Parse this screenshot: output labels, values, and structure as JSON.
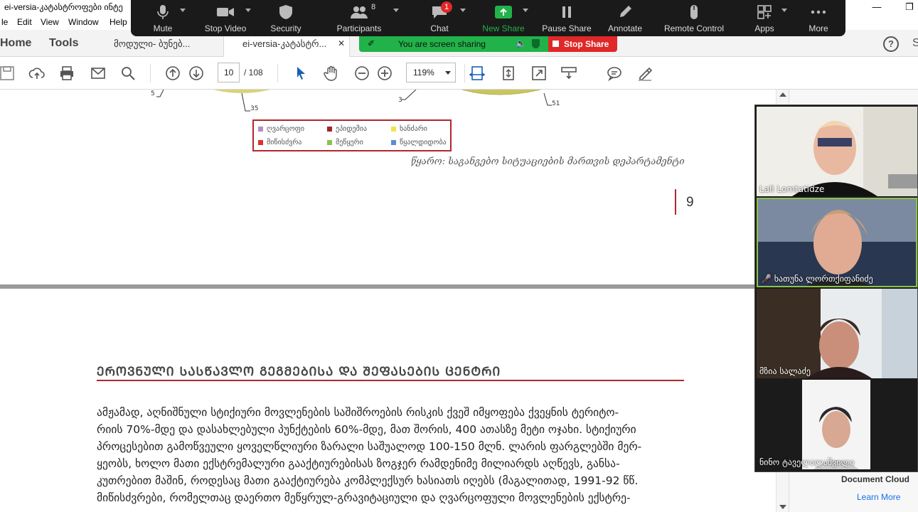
{
  "window": {
    "title": "ei-versia-კატასტროფები ინტე",
    "minimize": "—",
    "restore": "❐"
  },
  "menu": {
    "items": [
      "le",
      "Edit",
      "View",
      "Window",
      "Help"
    ]
  },
  "tabs": {
    "home": "Home",
    "tools": "Tools",
    "doc1": "მოდული- ბუნებ...",
    "doc2": "ei-versia-კატასტრ...",
    "close": "✕",
    "s_label": "S"
  },
  "toolbar": {
    "page_current": "10",
    "page_total": "/ 108",
    "zoom": "119%"
  },
  "zoom_bar": {
    "mute": "Mute",
    "stop_video": "Stop Video",
    "security": "Security",
    "participants": "Participants",
    "participants_count": "8",
    "chat": "Chat",
    "chat_badge": "1",
    "new_share": "New Share",
    "pause_share": "Pause Share",
    "annotate": "Annotate",
    "remote_control": "Remote Control",
    "apps": "Apps",
    "more": "More",
    "sharing_banner": "You are screen sharing",
    "stop_share": "Stop Share"
  },
  "document": {
    "chart_labels": [
      "5",
      "35",
      "3",
      "51"
    ],
    "legend": [
      {
        "label": "ღვარცოფი",
        "color": "#b48fc4"
      },
      {
        "label": "ეპიდემია",
        "color": "#a3232b"
      },
      {
        "label": "ხანძარი",
        "color": "#f2e34c"
      },
      {
        "label": "მიწისძვრა",
        "color": "#e03030"
      },
      {
        "label": "მეწყერი",
        "color": "#8bc34a"
      },
      {
        "label": "წყალდიდობა",
        "color": "#5b8fc7"
      }
    ],
    "source": "წყარო: საგანგებო სიტუაციების მართვის დეპარტამენტი",
    "page_number": "9",
    "heading": "ᲔᲠᲝᲕᲜᲣᲚᲘ ᲡᲐᲡᲬᲐᲕᲚᲝ ᲒᲔᲒᲛᲔᲑᲘᲡᲐ ᲓᲐ ᲨᲔᲤᲐᲡᲔᲑᲘᲡ ᲪᲔᲜᲢᲠᲘ",
    "paragraph": [
      "ამჟამად, აღნიშნული სტიქიური მოვლენების საშიშროების რისკის ქვეშ იმყოფება ქვეყნის ტერიტო-",
      "რიის 70%-მდე და დასახლებული პუნქტების 60%-მდე, მათ შორის, 400 ათასზე მეტი ოჯახი. სტიქიური",
      "პროცესებით გამოწვეული ყოველწლიური ზარალი საშუალოდ 100-150 მლნ. ლარის ფარგლებში მერ-",
      "ყეობს, ხოლო მათი ექსტრემალური გააქტიურებისას ზოგჯერ რამდენიმე მილიარდს აღწევს, განსა-",
      "კუთრებით მაშინ, როდესაც მათი გააქტიურება კომპლექსურ ხასიათს იღებს (მაგალითად, 1991-92 წწ.",
      "მიწისძვრები, რომელთაც დაერთო მეწყრულ-გრავიტაციული და ღვარცოფული მოვლენების ექსტრე-"
    ]
  },
  "participants": [
    {
      "name": "Lali Lomtatidze"
    },
    {
      "name": "ხათუნა ლორთქიფანიძე"
    },
    {
      "name": "მზია სალაძე"
    },
    {
      "name": "ნინო ტაველალაშვილი"
    }
  ],
  "side_panel": {
    "doc_cloud": "Document Cloud",
    "learn_more": "Learn More"
  }
}
